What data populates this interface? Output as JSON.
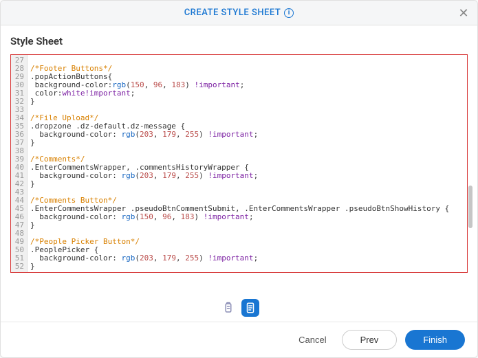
{
  "header": {
    "title": "CREATE STYLE SHEET",
    "info_glyph": "i",
    "close_glyph": "✕"
  },
  "section_title": "Style Sheet",
  "line_start": 27,
  "code_lines": [
    {
      "t": "empty"
    },
    {
      "t": "comment",
      "text": "/*Footer Buttons*/"
    },
    {
      "t": "sel",
      "text": ".popActionButtons{"
    },
    {
      "t": "prop",
      "pre": " background-color:",
      "func": "rgb",
      "args": "(150, 96, 183)",
      "imp": " !important",
      "end": ";"
    },
    {
      "t": "prop2",
      "pre": " color:",
      "val": "white",
      "imp": "!important",
      "end": ";"
    },
    {
      "t": "brace",
      "text": "}"
    },
    {
      "t": "empty"
    },
    {
      "t": "comment",
      "text": "/*File Upload*/"
    },
    {
      "t": "sel",
      "text": ".dropzone .dz-default.dz-message {"
    },
    {
      "t": "prop",
      "pre": "  background-color: ",
      "func": "rgb",
      "args": "(203, 179, 255)",
      "imp": " !important",
      "end": ";"
    },
    {
      "t": "brace",
      "text": "}"
    },
    {
      "t": "empty"
    },
    {
      "t": "comment",
      "text": "/*Comments*/"
    },
    {
      "t": "sel",
      "text": ".EnterCommentsWrapper, .commentsHistoryWrapper {"
    },
    {
      "t": "prop",
      "pre": "  background-color: ",
      "func": "rgb",
      "args": "(203, 179, 255)",
      "imp": " !important",
      "end": ";"
    },
    {
      "t": "brace",
      "text": "}"
    },
    {
      "t": "empty"
    },
    {
      "t": "comment",
      "text": "/*Comments Button*/"
    },
    {
      "t": "sel",
      "text": ".EnterCommentsWrapper .pseudoBtnCommentSubmit, .EnterCommentsWrapper .pseudoBtnShowHistory {"
    },
    {
      "t": "prop",
      "pre": "  background-color: ",
      "func": "rgb",
      "args": "(150, 96, 183)",
      "imp": " !important",
      "end": ";"
    },
    {
      "t": "brace",
      "text": "}"
    },
    {
      "t": "empty"
    },
    {
      "t": "comment",
      "text": "/*People Picker Button*/"
    },
    {
      "t": "sel",
      "text": ".PeoplePicker {"
    },
    {
      "t": "prop",
      "pre": "  background-color: ",
      "func": "rgb",
      "args": "(203, 179, 255)",
      "imp": " !important",
      "end": ";"
    },
    {
      "t": "brace",
      "text": "}"
    }
  ],
  "buttons": {
    "cancel": "Cancel",
    "prev": "Prev",
    "finish": "Finish"
  }
}
